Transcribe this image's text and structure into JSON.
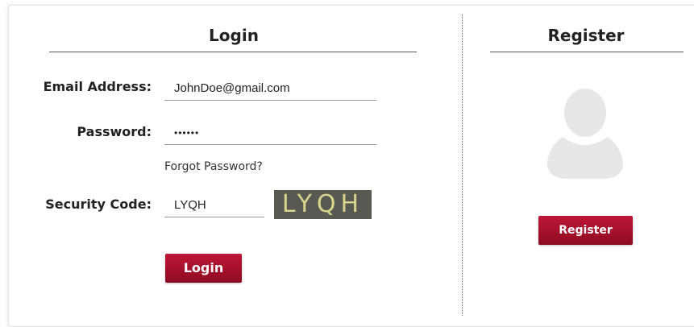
{
  "login": {
    "title": "Login",
    "email_label": "Email Address:",
    "email_value": "JohnDoe@gmail.com",
    "password_label": "Password:",
    "password_value": "••••••",
    "forgot_link": "Forgot Password?",
    "security_label": "Security Code:",
    "security_value": "LYQH",
    "captcha_text": "LYQH",
    "login_button": "Login"
  },
  "register": {
    "title": "Register",
    "register_button": "Register"
  },
  "colors": {
    "button_red": "#a3112b",
    "captcha_bg": "#595953",
    "captcha_text": "#d8d48a"
  },
  "icons": {
    "avatar": "user-silhouette-icon"
  }
}
